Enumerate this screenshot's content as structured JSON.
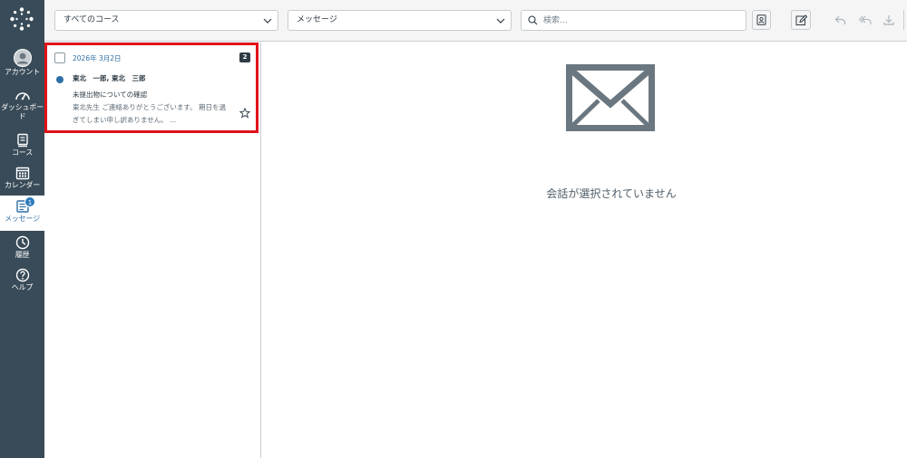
{
  "nav": {
    "account": "アカウント",
    "dashboard": "ダッシュボード",
    "courses": "コース",
    "calendar": "カレンダー",
    "messages": "メッセージ",
    "messages_badge": "1",
    "history": "履歴",
    "help": "ヘルプ"
  },
  "toolbar": {
    "course_filter": "すべてのコース",
    "type_filter": "メッセージ",
    "search_placeholder": "検索..."
  },
  "conversation": {
    "date": "2026年 3月2日",
    "message_count": "2",
    "participants": "東北　一郎, 東北　三郎",
    "subject": "未提出物についての確認",
    "preview": "東北先生 ご連絡ありがとうございます。 期日を過ぎてしまい申し訳ありません。 ..."
  },
  "detail": {
    "empty_message": "会話が選択されていません"
  },
  "colors": {
    "nav_bg": "#394b58",
    "accent": "#2d6ea6",
    "highlight_border": "#e0121a"
  }
}
